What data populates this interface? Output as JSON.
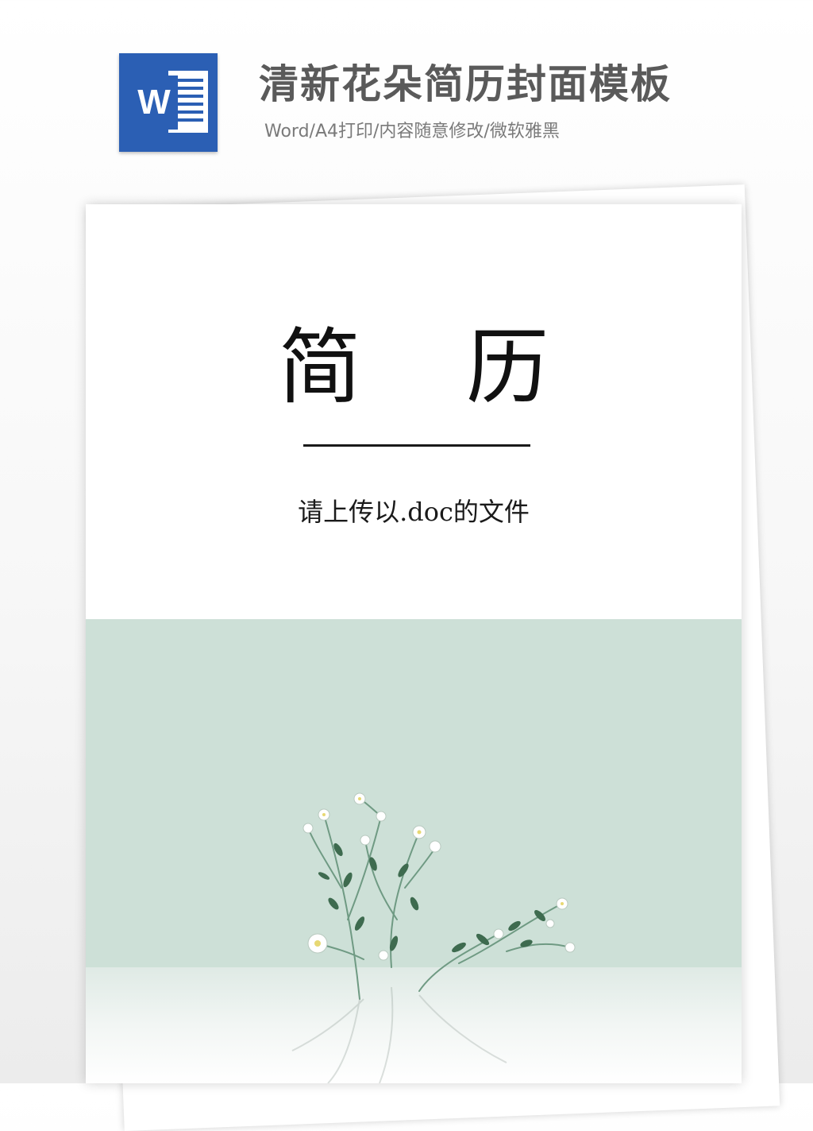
{
  "header": {
    "logo_letter": "W",
    "title": "清新花朵简历封面模板",
    "subtitle": "Word/A4打印/内容随意修改/微软雅黑"
  },
  "cover": {
    "title": "简    历",
    "note": "请上传以.doc的文件"
  },
  "colors": {
    "word_blue": "#2b5fb4",
    "panel_green": "#cde0d7",
    "header_text": "#5a5a5a"
  }
}
